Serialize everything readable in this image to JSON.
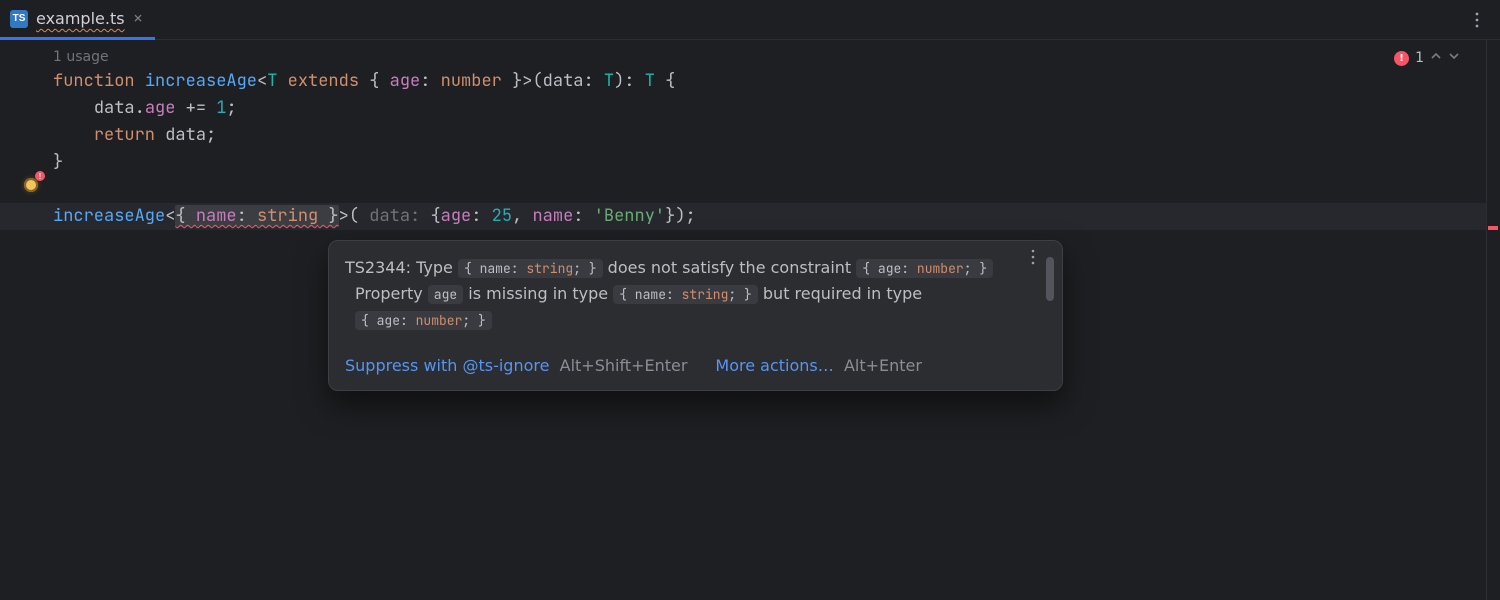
{
  "tab": {
    "icon_text": "TS",
    "filename": "example.ts",
    "close_glyph": "×"
  },
  "problems": {
    "error_glyph": "!",
    "count": "1"
  },
  "editor": {
    "usage_hint": "1 usage",
    "code": {
      "l1": {
        "kw_function": "function",
        "fn": "increaseAge",
        "lt": "<",
        "T": "T",
        "kw_extends": "extends",
        "obrace": "{",
        "age": "age",
        "colon1": ":",
        "number": "number",
        "cbrace": "}",
        "gt": ">(",
        "data": "data",
        "colon2": ":",
        "T2": "T",
        "rparen": "):",
        "T3": "T",
        "obrace2": "{"
      },
      "l2": {
        "indent": "    ",
        "data": "data",
        "dot": ".",
        "age": "age",
        "op": " += ",
        "one": "1",
        "semi": ";"
      },
      "l3": {
        "indent": "    ",
        "kw_return": "return",
        "data": "data",
        "semi": ";"
      },
      "l4": {
        "cbrace": "}"
      },
      "l6": {
        "fn": "increaseAge",
        "lt": "<",
        "err_open": "{ ",
        "err_name": "name",
        "err_colon": ": ",
        "err_string": "string",
        "err_close": " }",
        "gt": ">( ",
        "hint": "data:",
        "obrace": "{",
        "age": "age",
        "colon1": ": ",
        "n25": "25",
        "comma": ", ",
        "name2": "name",
        "colon2": ": ",
        "benny": "'Benny'",
        "cbrace": "}",
        "tail": ");"
      }
    }
  },
  "popup": {
    "line1": {
      "prefix": "TS2344: Type ",
      "chip1_a": "{ name: ",
      "chip1_kw": "string",
      "chip1_b": "; }",
      "mid": " does not satisfy the constraint ",
      "chip2_a": "{ age: ",
      "chip2_kw": "number",
      "chip2_b": "; }"
    },
    "line2": {
      "a": "Property ",
      "chip_age": "age",
      "b": " is missing in type ",
      "chip3_a": "{ name: ",
      "chip3_kw": "string",
      "chip3_b": "; }",
      "c": " but required in type ",
      "chip4_a": "{ age: ",
      "chip4_kw": "number",
      "chip4_b": "; }"
    },
    "actions": {
      "suppress": "Suppress with @ts-ignore",
      "suppress_shortcut": "Alt+Shift+Enter",
      "more": "More actions…",
      "more_shortcut": "Alt+Enter"
    }
  },
  "gutter": {
    "bang": "!"
  }
}
